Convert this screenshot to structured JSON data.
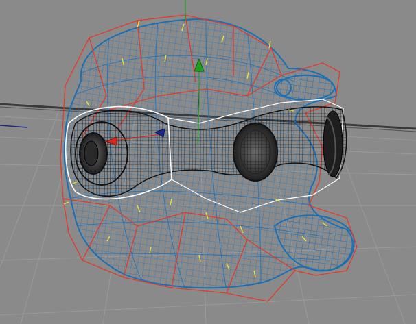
{
  "viewport": {
    "view": "perspective",
    "background": "#8a8a8a",
    "grid_color": "#9c9c9c",
    "horizon_color": "#3a3a3a"
  },
  "model": {
    "name": "",
    "mesh_color": "#1a6fb5",
    "cage_color": "#e23a2a",
    "selected_wire_color": "#111111",
    "selected_outline_color": "#ffffff",
    "normals_color": "#e8e23a"
  },
  "gizmo": {
    "x_axis_color": "#d8281c",
    "y_axis_color": "#1fa01f",
    "z_axis_color": "#1b2a8a"
  }
}
